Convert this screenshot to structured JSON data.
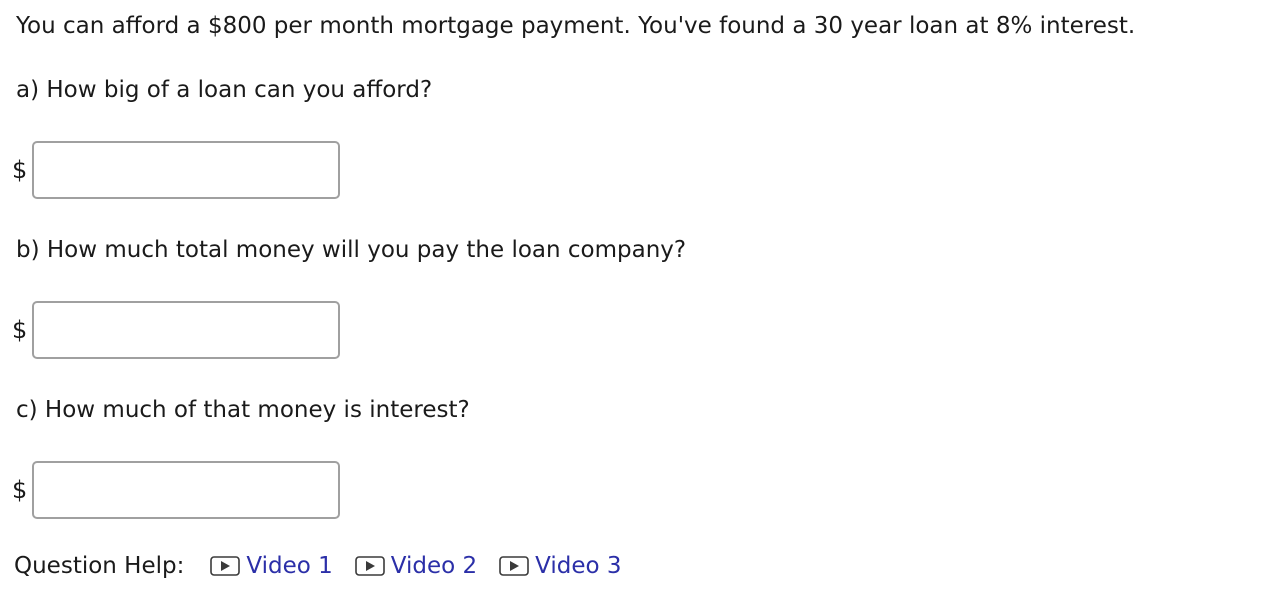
{
  "problem": {
    "statement": "You can afford a $800 per month mortgage payment. You've found a 30 year loan at 8% interest."
  },
  "parts": [
    {
      "question": "a) How big of a loan can you afford?",
      "prefix": "$",
      "value": ""
    },
    {
      "question": "b) How much total money will you pay the loan company?",
      "prefix": "$",
      "value": ""
    },
    {
      "question": "c) How much of that money is interest?",
      "prefix": "$",
      "value": ""
    }
  ],
  "help": {
    "label": "Question Help:",
    "videos": [
      {
        "label": "Video 1",
        "icon": "play-icon"
      },
      {
        "label": "Video 2",
        "icon": "play-icon"
      },
      {
        "label": "Video 3",
        "icon": "play-icon"
      }
    ],
    "link_color": "#2b2fa8"
  }
}
